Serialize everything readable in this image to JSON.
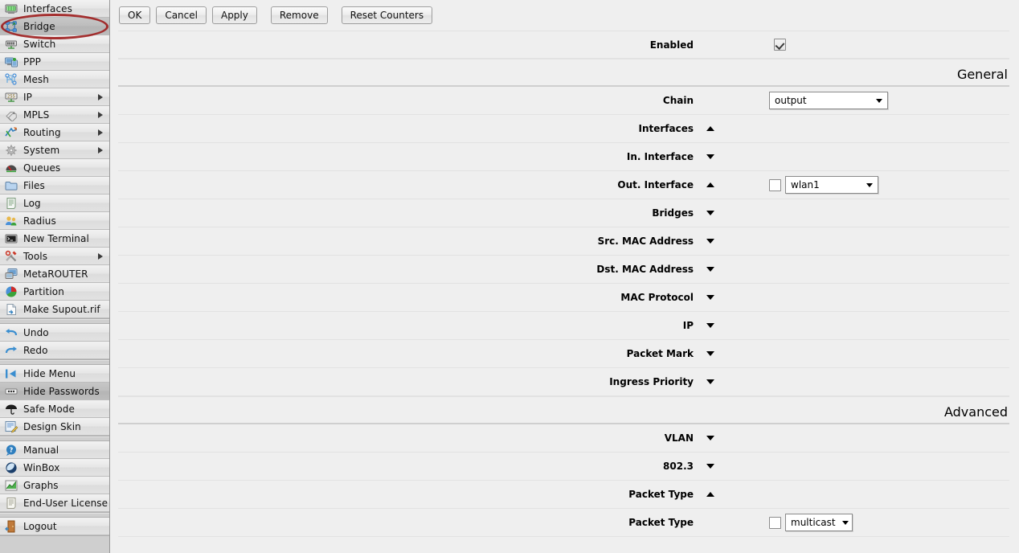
{
  "sidebar": {
    "groups": [
      {
        "items": [
          {
            "label": "Interfaces",
            "icon": "interfaces-icon",
            "arrow": false,
            "selected": false,
            "highlight": false
          },
          {
            "label": "Bridge",
            "icon": "bridge-icon",
            "arrow": false,
            "selected": true,
            "highlight": true
          },
          {
            "label": "Switch",
            "icon": "switch-icon",
            "arrow": false,
            "selected": false,
            "highlight": false
          },
          {
            "label": "PPP",
            "icon": "ppp-icon",
            "arrow": false,
            "selected": false,
            "highlight": false
          },
          {
            "label": "Mesh",
            "icon": "mesh-icon",
            "arrow": false,
            "selected": false,
            "highlight": false
          },
          {
            "label": "IP",
            "icon": "ip-icon",
            "arrow": true,
            "selected": false,
            "highlight": false
          },
          {
            "label": "MPLS",
            "icon": "mpls-icon",
            "arrow": true,
            "selected": false,
            "highlight": false
          },
          {
            "label": "Routing",
            "icon": "routing-icon",
            "arrow": true,
            "selected": false,
            "highlight": false
          },
          {
            "label": "System",
            "icon": "system-icon",
            "arrow": true,
            "selected": false,
            "highlight": false
          },
          {
            "label": "Queues",
            "icon": "queues-icon",
            "arrow": false,
            "selected": false,
            "highlight": false
          },
          {
            "label": "Files",
            "icon": "files-icon",
            "arrow": false,
            "selected": false,
            "highlight": false
          },
          {
            "label": "Log",
            "icon": "log-icon",
            "arrow": false,
            "selected": false,
            "highlight": false
          },
          {
            "label": "Radius",
            "icon": "radius-icon",
            "arrow": false,
            "selected": false,
            "highlight": false
          },
          {
            "label": "New Terminal",
            "icon": "terminal-icon",
            "arrow": false,
            "selected": false,
            "highlight": false
          },
          {
            "label": "Tools",
            "icon": "tools-icon",
            "arrow": true,
            "selected": false,
            "highlight": false
          },
          {
            "label": "MetaROUTER",
            "icon": "metarouter-icon",
            "arrow": false,
            "selected": false,
            "highlight": false
          },
          {
            "label": "Partition",
            "icon": "partition-icon",
            "arrow": false,
            "selected": false,
            "highlight": false
          },
          {
            "label": "Make Supout.rif",
            "icon": "supout-icon",
            "arrow": false,
            "selected": false,
            "highlight": false
          }
        ]
      },
      {
        "items": [
          {
            "label": "Undo",
            "icon": "undo-icon",
            "arrow": false,
            "selected": false,
            "highlight": false
          },
          {
            "label": "Redo",
            "icon": "redo-icon",
            "arrow": false,
            "selected": false,
            "highlight": false
          }
        ]
      },
      {
        "items": [
          {
            "label": "Hide Menu",
            "icon": "hide-menu-icon",
            "arrow": false,
            "selected": false,
            "highlight": false
          },
          {
            "label": "Hide Passwords",
            "icon": "hide-passwords-icon",
            "arrow": false,
            "selected": true,
            "highlight": false
          },
          {
            "label": "Safe Mode",
            "icon": "safe-mode-icon",
            "arrow": false,
            "selected": false,
            "highlight": false
          },
          {
            "label": "Design Skin",
            "icon": "design-skin-icon",
            "arrow": false,
            "selected": false,
            "highlight": false
          }
        ]
      },
      {
        "items": [
          {
            "label": "Manual",
            "icon": "manual-icon",
            "arrow": false,
            "selected": false,
            "highlight": false
          },
          {
            "label": "WinBox",
            "icon": "winbox-icon",
            "arrow": false,
            "selected": false,
            "highlight": false
          },
          {
            "label": "Graphs",
            "icon": "graphs-icon",
            "arrow": false,
            "selected": false,
            "highlight": false
          },
          {
            "label": "End-User License",
            "icon": "license-icon",
            "arrow": false,
            "selected": false,
            "highlight": false
          }
        ]
      },
      {
        "items": [
          {
            "label": "Logout",
            "icon": "logout-icon",
            "arrow": false,
            "selected": false,
            "highlight": false
          }
        ]
      }
    ]
  },
  "toolbar": {
    "buttons": [
      {
        "label": "OK",
        "name": "ok-button"
      },
      {
        "label": "Cancel",
        "name": "cancel-button"
      },
      {
        "label": "Apply",
        "name": "apply-button"
      },
      {
        "label": "Remove",
        "name": "remove-button"
      },
      {
        "label": "Reset Counters",
        "name": "reset-counters-button"
      }
    ]
  },
  "form": {
    "enabled": {
      "label": "Enabled",
      "checked": true
    },
    "sections": {
      "general": "General",
      "advanced": "Advanced"
    },
    "chain": {
      "label": "Chain",
      "value": "output"
    },
    "interfaces": {
      "label": "Interfaces",
      "expanded": true
    },
    "in_interface": {
      "label": "In. Interface",
      "expanded": false
    },
    "out_interface": {
      "label": "Out. Interface",
      "expanded": true,
      "negate_checked": false,
      "value": "wlan1"
    },
    "bridges": {
      "label": "Bridges",
      "expanded": false
    },
    "src_mac_address": {
      "label": "Src. MAC Address",
      "expanded": false
    },
    "dst_mac_address": {
      "label": "Dst. MAC Address",
      "expanded": false
    },
    "mac_protocol": {
      "label": "MAC Protocol",
      "expanded": false
    },
    "ip": {
      "label": "IP",
      "expanded": false
    },
    "packet_mark": {
      "label": "Packet Mark",
      "expanded": false
    },
    "ingress_priority": {
      "label": "Ingress Priority",
      "expanded": false
    },
    "vlan": {
      "label": "VLAN",
      "expanded": false
    },
    "dot3": {
      "label": "802.3",
      "expanded": false
    },
    "packet_type_group": {
      "label": "Packet Type",
      "expanded": true
    },
    "packet_type_field": {
      "label": "Packet Type",
      "negate_checked": false,
      "value": "multicast"
    }
  },
  "colors": {
    "highlight_ellipse": "#9e2020",
    "sidebar_bg": "#cfcfcf",
    "content_bg": "#efefef"
  }
}
